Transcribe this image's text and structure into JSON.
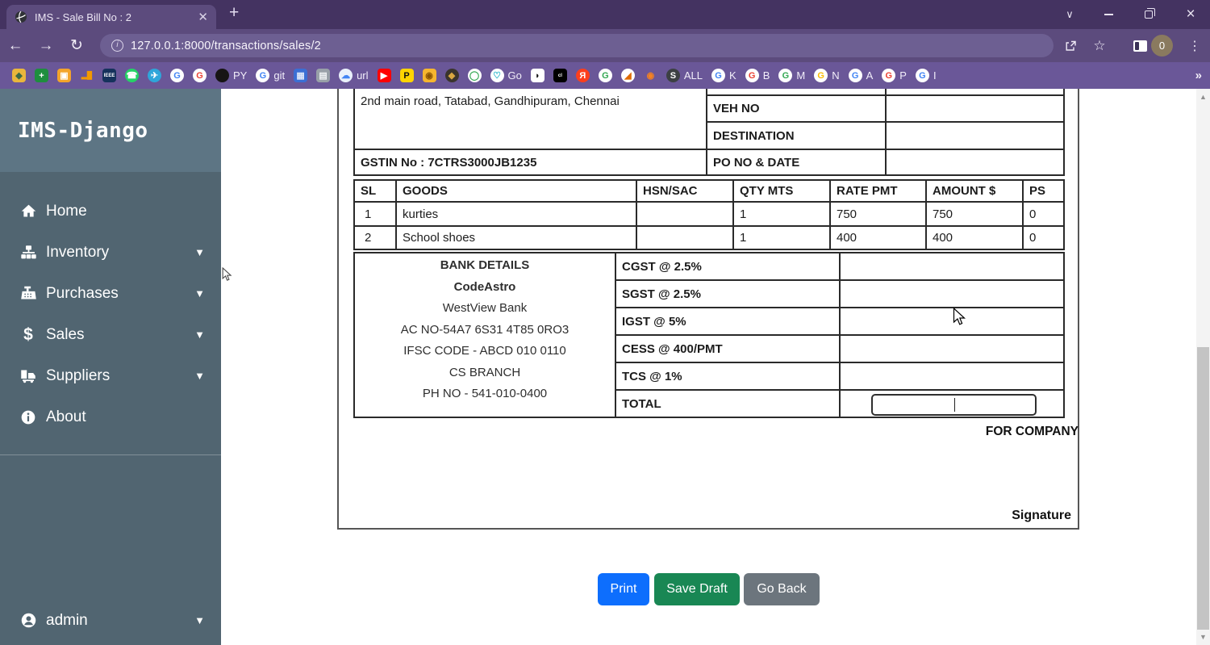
{
  "browser": {
    "tab_title": "IMS - Sale Bill No : 2",
    "url": "127.0.0.1:8000/transactions/sales/2",
    "profile_initial": "0",
    "new_tab_glyph": "+",
    "bookmarks_overflow": "»"
  },
  "bookmarks": [
    {
      "name": "adsense",
      "glyph": "◆",
      "bg": "#e9b63c",
      "fg": "#3c6b46",
      "shape": "square",
      "text": ""
    },
    {
      "name": "sheets",
      "glyph": "+",
      "bg": "#1e8e3e",
      "fg": "#ffffff",
      "shape": "square",
      "text": ""
    },
    {
      "name": "photos-orange",
      "glyph": "▣",
      "bg": "#f3a42b",
      "fg": "#ffffff",
      "shape": "square",
      "text": ""
    },
    {
      "name": "analytics",
      "glyph": "▂█",
      "bg": "transparent",
      "fg": "#f29900",
      "shape": "square",
      "text": ""
    },
    {
      "name": "ieee",
      "glyph": "IEEE",
      "bg": "#16325c",
      "fg": "#ffffff",
      "shape": "square",
      "text": "",
      "tiny": true
    },
    {
      "name": "whatsapp",
      "glyph": "☎",
      "bg": "#25d366",
      "fg": "#ffffff",
      "shape": "round",
      "text": ""
    },
    {
      "name": "telegram",
      "glyph": "✈",
      "bg": "#2ea6da",
      "fg": "#ffffff",
      "shape": "round",
      "text": ""
    },
    {
      "name": "google-1",
      "glyph": "G",
      "bg": "#ffffff",
      "fg": "#4285f4",
      "shape": "round",
      "text": ""
    },
    {
      "name": "google-2",
      "glyph": "G",
      "bg": "#ffffff",
      "fg": "#ea4335",
      "shape": "round",
      "text": ""
    },
    {
      "name": "github-py",
      "glyph": "",
      "bg": "#171515",
      "fg": "#ffffff",
      "shape": "round",
      "text": "PY"
    },
    {
      "name": "google-git",
      "glyph": "G",
      "bg": "#ffffff",
      "fg": "#4285f4",
      "shape": "round",
      "text": "git"
    },
    {
      "name": "app-blue",
      "glyph": "▦",
      "bg": "#3b6fd4",
      "fg": "#dce6f9",
      "shape": "square",
      "text": ""
    },
    {
      "name": "app-gray",
      "glyph": "▤",
      "bg": "#98a0a8",
      "fg": "#f2f4f6",
      "shape": "square",
      "text": ""
    },
    {
      "name": "cloud-url",
      "glyph": "☁",
      "bg": "#eaf1fb",
      "fg": "#4285f4",
      "shape": "round",
      "text": "url"
    },
    {
      "name": "youtube",
      "glyph": "▶",
      "bg": "#ff0000",
      "fg": "#ffffff",
      "shape": "square",
      "text": ""
    },
    {
      "name": "p-yellow",
      "glyph": "P",
      "bg": "#ffd400",
      "fg": "#111111",
      "shape": "square",
      "text": ""
    },
    {
      "name": "camera-orange",
      "glyph": "◉",
      "bg": "#f6b62e",
      "fg": "#8a5400",
      "shape": "square",
      "text": ""
    },
    {
      "name": "cart-dark",
      "glyph": "◆",
      "bg": "#3a342d",
      "fg": "#d9a741",
      "shape": "round",
      "text": ""
    },
    {
      "name": "ring-green",
      "glyph": "◯",
      "bg": "#ffffff",
      "fg": "#34a853",
      "shape": "round",
      "text": ""
    },
    {
      "name": "godaddy",
      "glyph": "♡",
      "bg": "#ffffff",
      "fg": "#17b1c7",
      "shape": "round",
      "text": "Go"
    },
    {
      "name": "bird",
      "glyph": "◗",
      "bg": "#ffffff",
      "fg": "#111111",
      "shape": "square",
      "text": ""
    },
    {
      "name": "cl",
      "glyph": "cl",
      "bg": "#000000",
      "fg": "#ffffff",
      "shape": "square",
      "text": "",
      "tiny": true
    },
    {
      "name": "yandex",
      "glyph": "Я",
      "bg": "#fc3f1d",
      "fg": "#ffffff",
      "shape": "round",
      "text": ""
    },
    {
      "name": "google-3",
      "glyph": "G",
      "bg": "#ffffff",
      "fg": "#34a853",
      "shape": "round",
      "text": ""
    },
    {
      "name": "matlab",
      "glyph": "◢",
      "bg": "#ffffff",
      "fg": "#e06c00",
      "shape": "round",
      "text": ""
    },
    {
      "name": "eye-orange",
      "glyph": "◉",
      "bg": "transparent",
      "fg": "#f58220",
      "shape": "round",
      "text": ""
    },
    {
      "name": "globe-all",
      "glyph": "S",
      "bg": "#3c4043",
      "fg": "#ffffff",
      "shape": "round",
      "text": "ALL"
    },
    {
      "name": "google-k",
      "glyph": "G",
      "bg": "#ffffff",
      "fg": "#4285f4",
      "shape": "round",
      "text": "K"
    },
    {
      "name": "google-b",
      "glyph": "G",
      "bg": "#ffffff",
      "fg": "#ea4335",
      "shape": "round",
      "text": "B"
    },
    {
      "name": "google-m",
      "glyph": "G",
      "bg": "#ffffff",
      "fg": "#34a853",
      "shape": "round",
      "text": "M"
    },
    {
      "name": "google-n",
      "glyph": "G",
      "bg": "#ffffff",
      "fg": "#fbbc05",
      "shape": "round",
      "text": "N"
    },
    {
      "name": "google-a",
      "glyph": "G",
      "bg": "#ffffff",
      "fg": "#4285f4",
      "shape": "round",
      "text": "A"
    },
    {
      "name": "google-p",
      "glyph": "G",
      "bg": "#ffffff",
      "fg": "#ea4335",
      "shape": "round",
      "text": "P"
    },
    {
      "name": "google-i",
      "glyph": "G",
      "bg": "#ffffff",
      "fg": "#4285f4",
      "shape": "round",
      "text": "I"
    }
  ],
  "sidebar": {
    "brand": "IMS-Django",
    "items": [
      {
        "label": "Home"
      },
      {
        "label": "Inventory"
      },
      {
        "label": "Purchases"
      },
      {
        "label": "Sales"
      },
      {
        "label": "Suppliers"
      },
      {
        "label": "About"
      }
    ],
    "user": "admin"
  },
  "invoice": {
    "address": "2nd main road, Tatabad, Gandhipuram, Chennai",
    "gstin": "GSTIN No : 7CTRS3000JB1235",
    "meta": [
      {
        "label": "VEH NO",
        "value": ""
      },
      {
        "label": "DESTINATION",
        "value": ""
      },
      {
        "label": "PO NO & DATE",
        "value": ""
      }
    ],
    "goods": {
      "headers": [
        "SL",
        "GOODS",
        "HSN/SAC",
        "QTY MTS",
        "RATE PMT",
        "AMOUNT $",
        "PS"
      ],
      "rows": [
        [
          "1",
          "kurties",
          "",
          "1",
          "750",
          "750",
          "0"
        ],
        [
          "2",
          "School shoes",
          "",
          "1",
          "400",
          "400",
          "0"
        ]
      ]
    },
    "bank_lines": [
      "BANK DETAILS",
      "CodeAstro",
      "WestView Bank",
      "AC NO-54A7 6S31 4T85 0RO3",
      "IFSC CODE - ABCD 010 0110",
      "CS BRANCH",
      "PH NO - 541-010-0400"
    ],
    "taxes": [
      {
        "label": "CGST @ 2.5%",
        "value": ""
      },
      {
        "label": "SGST @ 2.5%",
        "value": ""
      },
      {
        "label": "IGST @ 5%",
        "value": ""
      },
      {
        "label": "CESS @ 400/PMT",
        "value": ""
      },
      {
        "label": "TCS @ 1%",
        "value": ""
      },
      {
        "label": "TOTAL",
        "value": ""
      }
    ],
    "total_input_value": "",
    "for_company": "FOR COMPANY",
    "signature": "Signature"
  },
  "actions": {
    "print": "Print",
    "save_draft": "Save Draft",
    "go_back": "Go Back"
  },
  "colors": {
    "print_btn": "#0d6efd",
    "save_btn": "#198754",
    "back_btn": "#6c757d",
    "chrome_titlebar": "#443361",
    "chrome_toolbar": "#5c4b7d",
    "bookmarks_bar": "#6a5798",
    "sidebar_bg": "#516571",
    "sidebar_header_bg": "#5d7584"
  }
}
